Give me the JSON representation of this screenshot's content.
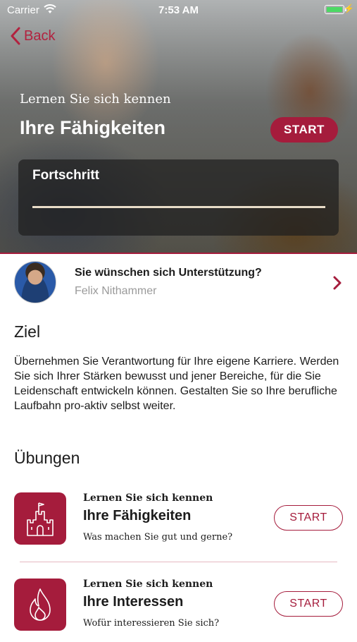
{
  "status_bar": {
    "carrier": "Carrier",
    "time": "7:53 AM"
  },
  "nav": {
    "back_label": "Back"
  },
  "hero": {
    "subtitle": "Lernen Sie sich kennen",
    "title": "Ihre Fähigkeiten",
    "start_label": "START",
    "progress_label": "Fortschritt"
  },
  "support": {
    "title": "Sie wünschen sich Unterstützung?",
    "name": "Felix Nithammer"
  },
  "goal": {
    "heading": "Ziel",
    "text": "Übernehmen Sie Verantwortung für Ihre eigene Karriere. Werden Sie sich Ihrer Stärken bewusst und jener Bereiche, für die Sie Leidenschaft entwickeln können. Gestalten Sie so Ihre berufliche Laufbahn pro-aktiv selbst weiter."
  },
  "exercises": {
    "heading": "Übungen",
    "items": [
      {
        "subtitle": "Lernen Sie sich kennen",
        "title": "Ihre Fähigkeiten",
        "description": "Was machen Sie gut und gerne?",
        "start_label": "START",
        "icon": "castle-icon"
      },
      {
        "subtitle": "Lernen Sie sich kennen",
        "title": "Ihre Interessen",
        "description": "Wofür interessieren Sie sich?",
        "start_label": "START",
        "icon": "flame-icon"
      }
    ]
  },
  "colors": {
    "accent": "#a51c3c",
    "back": "#b2223f",
    "battery": "#4cd964"
  }
}
